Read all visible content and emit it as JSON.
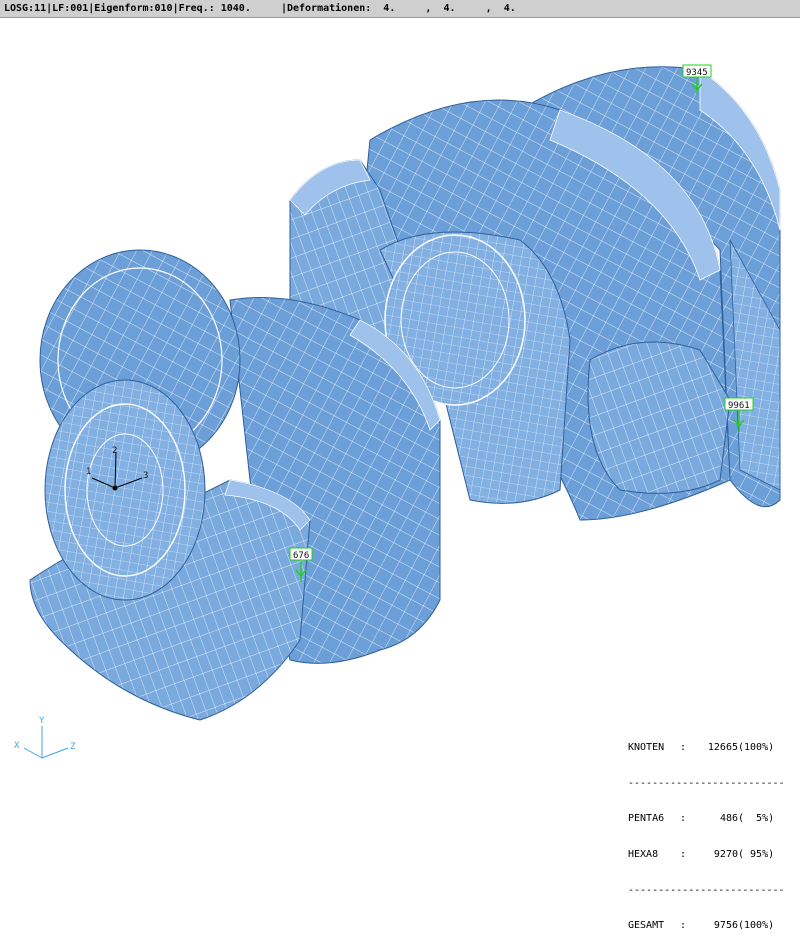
{
  "status_bar": {
    "text": "LOSG:11|LF:001|Eigenform:010|Freq.: 1040.     |Deformationen:  4.     ,  4.     ,  4."
  },
  "model": {
    "fill_color": "#6c9fd8",
    "light_fill": "#9ec2ec",
    "dark_fill": "#4a7fc0",
    "mesh_color": "#ffffff",
    "marker_color": "#1fcf1f",
    "local_axes": {
      "x": "1",
      "y": "2",
      "z": "3"
    },
    "node_markers": [
      {
        "id": "9345"
      },
      {
        "id": "9961"
      },
      {
        "id": "676"
      }
    ]
  },
  "stats": {
    "knoten": {
      "name": "KNOTEN",
      "count": "12665",
      "pct": "(100%)"
    },
    "separator": "--------------------------",
    "penta6": {
      "name": "PENTA6",
      "count": "486",
      "pct": "(  5%)"
    },
    "hexa8": {
      "name": "HEXA8",
      "count": "9270",
      "pct": "( 95%)"
    },
    "gesamt": {
      "name": "GESAMT",
      "count": "9756",
      "pct": "(100%)"
    }
  },
  "global_axes": {
    "x": "X",
    "y": "Y",
    "z": "Z",
    "color": "#3da6e8"
  }
}
